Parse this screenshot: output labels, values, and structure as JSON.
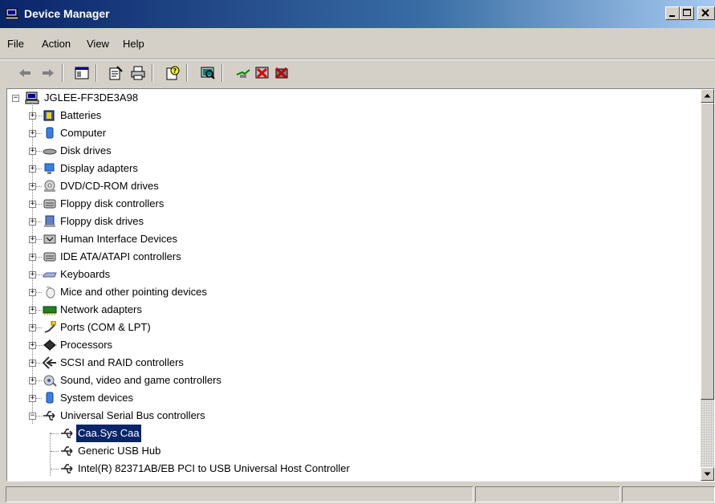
{
  "window": {
    "title": "Device Manager",
    "controls": [
      "minimize",
      "maximize",
      "close"
    ]
  },
  "menu": {
    "items": [
      "File",
      "Action",
      "View",
      "Help"
    ]
  },
  "toolbar": {
    "buttons": [
      {
        "name": "back-icon"
      },
      {
        "name": "forward-icon"
      },
      {
        "name": "show-hide-console-tree-icon"
      },
      {
        "name": "properties-icon"
      },
      {
        "name": "print-icon"
      },
      {
        "name": "help-icon"
      },
      {
        "name": "scan-hardware-changes-icon"
      },
      {
        "name": "update-driver-icon"
      },
      {
        "name": "disable-device-icon"
      },
      {
        "name": "uninstall-device-icon"
      }
    ]
  },
  "tree": {
    "root": "JGLEE-FF3DE3A98",
    "categories": [
      {
        "label": "Batteries",
        "icon": "battery-icon",
        "expanded": false
      },
      {
        "label": "Computer",
        "icon": "computer-icon",
        "expanded": false
      },
      {
        "label": "Disk drives",
        "icon": "disk-drive-icon",
        "expanded": false
      },
      {
        "label": "Display adapters",
        "icon": "display-adapter-icon",
        "expanded": false
      },
      {
        "label": "DVD/CD-ROM drives",
        "icon": "cdrom-icon",
        "expanded": false
      },
      {
        "label": "Floppy disk controllers",
        "icon": "controller-icon",
        "expanded": false
      },
      {
        "label": "Floppy disk drives",
        "icon": "floppy-icon",
        "expanded": false
      },
      {
        "label": "Human Interface Devices",
        "icon": "hid-icon",
        "expanded": false
      },
      {
        "label": "IDE ATA/ATAPI controllers",
        "icon": "controller-icon",
        "expanded": false
      },
      {
        "label": "Keyboards",
        "icon": "keyboard-icon",
        "expanded": false
      },
      {
        "label": "Mice and other pointing devices",
        "icon": "mouse-icon",
        "expanded": false
      },
      {
        "label": "Network adapters",
        "icon": "network-adapter-icon",
        "expanded": false
      },
      {
        "label": "Ports (COM & LPT)",
        "icon": "port-icon",
        "expanded": false
      },
      {
        "label": "Processors",
        "icon": "processor-icon",
        "expanded": false
      },
      {
        "label": "SCSI and RAID controllers",
        "icon": "scsi-icon",
        "expanded": false
      },
      {
        "label": "Sound, video and game controllers",
        "icon": "sound-icon",
        "expanded": false
      },
      {
        "label": "System devices",
        "icon": "system-device-icon",
        "expanded": false
      },
      {
        "label": "Universal Serial Bus controllers",
        "icon": "usb-icon",
        "expanded": true,
        "children": [
          {
            "label": "Caa.Sys Caa",
            "selected": true
          },
          {
            "label": "Generic USB Hub",
            "selected": false
          },
          {
            "label": "Intel(R) 82371AB/EB PCI to USB Universal Host Controller",
            "selected": false
          }
        ]
      }
    ]
  },
  "colors": {
    "selection": "#0a246a",
    "face": "#d4d0c8"
  }
}
